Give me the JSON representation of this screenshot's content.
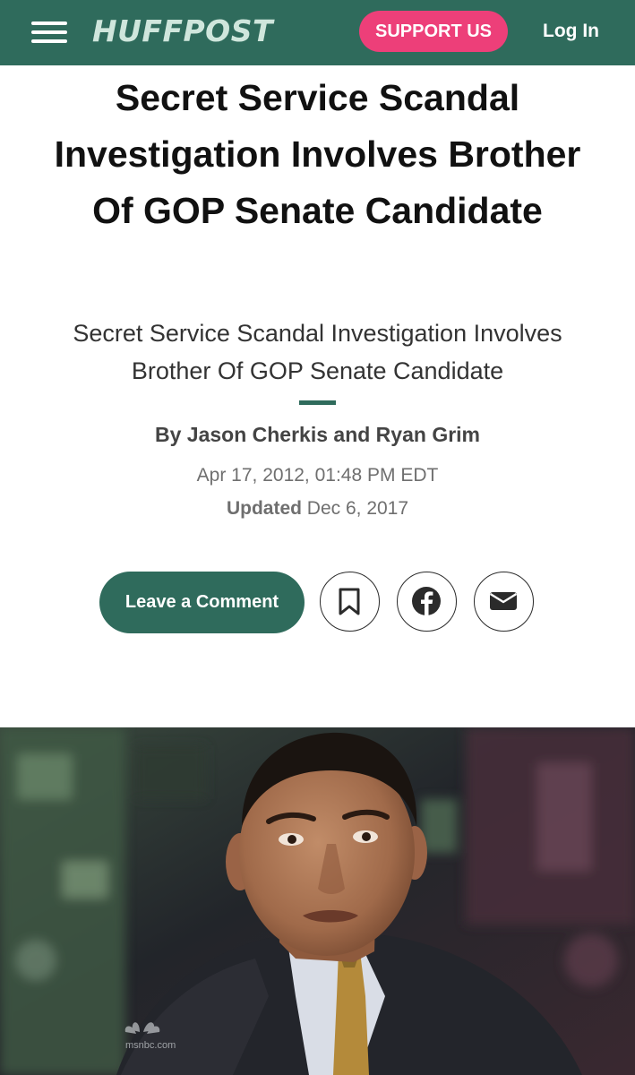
{
  "header": {
    "logo": "HUFFPOST",
    "support_label": "SUPPORT US",
    "login_label": "Log In",
    "menu_icon": "hamburger-menu-icon"
  },
  "article": {
    "headline": "Secret Service Scandal Investigation Involves Brother Of GOP Senate Candidate",
    "subheadline": "Secret Service Scandal Investigation Involves Brother Of GOP Senate Candidate",
    "byline": "By Jason Cherkis and Ryan Grim",
    "published": "Apr 17, 2012, 01:48 PM EDT",
    "updated_label": "Updated",
    "updated_date": "Dec 6, 2017"
  },
  "actions": {
    "comment_label": "Leave a Comment",
    "bookmark_icon": "bookmark-icon",
    "facebook_icon": "facebook-icon",
    "email_icon": "email-icon"
  },
  "photo": {
    "watermark": "msnbc.com"
  },
  "colors": {
    "brand_green": "#2f6b5c",
    "support_pink": "#ed3f79",
    "logo_mint": "#cfe6dc"
  }
}
